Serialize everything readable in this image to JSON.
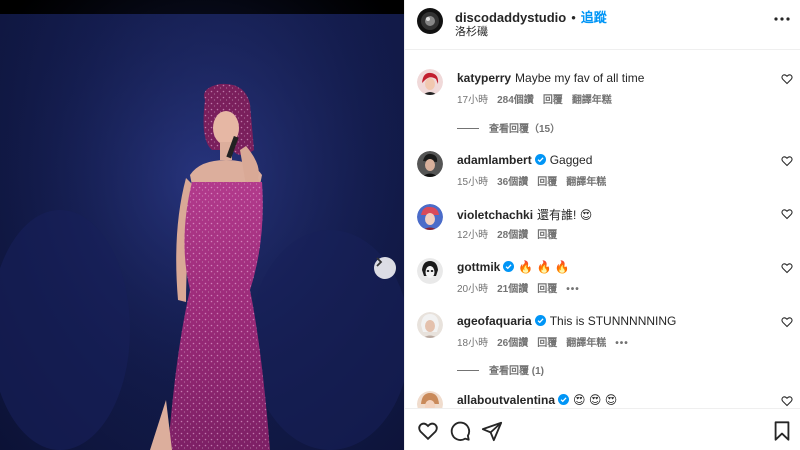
{
  "post": {
    "username": "discodaddystudio",
    "follow_label": "追蹤",
    "separator": "•",
    "location": "洛杉磯",
    "more_icon": "more-horizontal-icon"
  },
  "comments": [
    {
      "username": "katyperry",
      "verified": false,
      "text": "Maybe my fav of all time",
      "time": "17小時",
      "likes": "284個讚",
      "reply": "回覆",
      "translate": "翻譯年糕",
      "more": "",
      "avatar_color": "#c21f2f"
    },
    {
      "username": "adamlambert",
      "verified": true,
      "text": "Gagged",
      "time": "15小時",
      "likes": "36個讚",
      "reply": "回覆",
      "translate": "翻譯年糕",
      "more": "",
      "avatar_color": "#3b3b3b"
    },
    {
      "username": "violetchachki",
      "verified": false,
      "text": "還有誰! 😍",
      "time": "12小時",
      "likes": "28個讚",
      "reply": "回覆",
      "translate": "",
      "more": "",
      "avatar_color": "#d94a5a"
    },
    {
      "username": "gottmik",
      "verified": true,
      "text": "🔥 🔥 🔥",
      "time": "20小時",
      "likes": "21個讚",
      "reply": "回覆",
      "translate": "",
      "more": "•••",
      "avatar_color": "#1a1a1a"
    },
    {
      "username": "ageofaquaria",
      "verified": true,
      "text": "This is STUNNNNNING",
      "time": "18小時",
      "likes": "26個讚",
      "reply": "回覆",
      "translate": "翻譯年糕",
      "more": "•••",
      "avatar_color": "#b9a9a0"
    },
    {
      "username": "allaboutvalentina",
      "verified": true,
      "text": "😍 😍 😍",
      "time": "",
      "likes": "",
      "reply": "",
      "translate": "",
      "more": "",
      "avatar_color": "#c98a5a"
    }
  ],
  "view_replies": [
    {
      "label": "查看回覆（15）"
    },
    {
      "label": "查看回覆 (1)"
    }
  ],
  "actions": {
    "like_icon": "heart-icon",
    "comment_icon": "comment-icon",
    "share_icon": "share-icon",
    "save_icon": "bookmark-icon"
  },
  "colors": {
    "accent": "#0095f6",
    "verified": "#0095f6",
    "muted_text": "#737373",
    "dress": "#a0307e"
  }
}
